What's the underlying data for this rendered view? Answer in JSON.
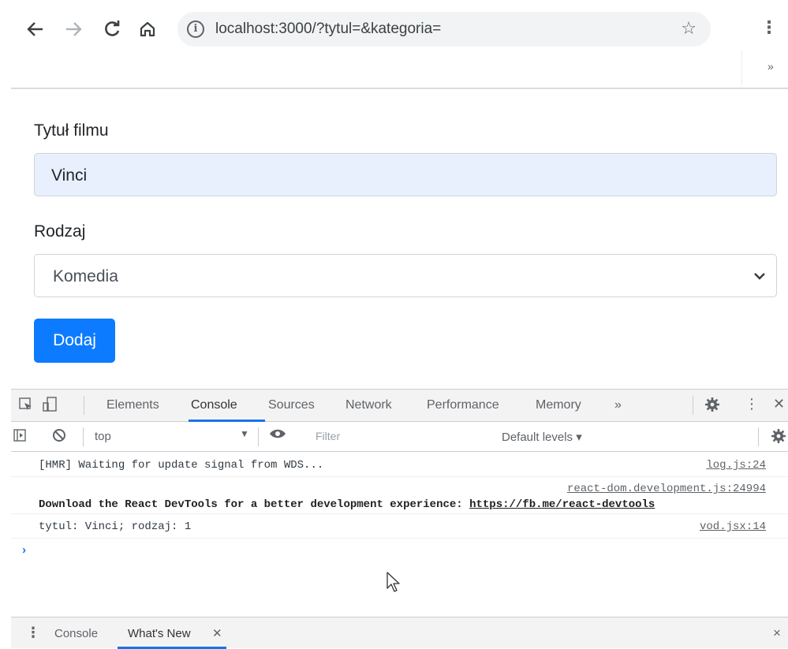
{
  "browser": {
    "back_icon": "arrow-left",
    "forward_icon": "arrow-right",
    "reload_icon": "reload",
    "home_icon": "home",
    "url": "localhost:3000/?tytul=&kategoria=",
    "more_bookmarks": "»"
  },
  "form": {
    "title_label": "Tytuł filmu",
    "title_value": "Vinci",
    "genre_label": "Rodzaj",
    "genre_selected": "Komedia",
    "submit_label": "Dodaj",
    "accent_color": "#0d7bff",
    "autofill_bg": "#e8f0fe"
  },
  "devtools": {
    "tabs": [
      "Elements",
      "Console",
      "Sources",
      "Network",
      "Performance",
      "Memory"
    ],
    "active_tab": "Console",
    "more_tabs": "»",
    "context": "top",
    "filter_placeholder": "Filter",
    "levels": "Default levels ▾",
    "messages": [
      {
        "text": "[HMR] Waiting for update signal from WDS...",
        "source": "log.js:24"
      },
      {
        "text_prefix": "Download the React DevTools for a better development experience: ",
        "link": "https://fb.me/react-devtools",
        "source": "react-dom.development.js:24994"
      },
      {
        "text": "tytul: Vinci; rodzaj: 1",
        "source": "vod.jsx:14"
      }
    ],
    "prompt": "›",
    "drawer_tabs": [
      "Console",
      "What's New"
    ],
    "drawer_close": "×",
    "active_color": "#1a73e8"
  }
}
